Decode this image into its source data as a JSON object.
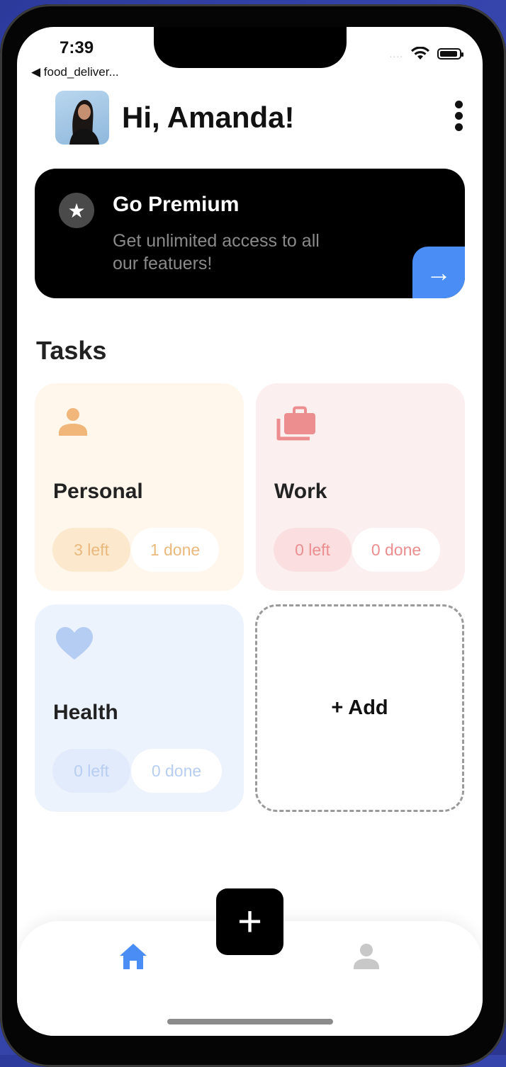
{
  "status_bar": {
    "time": "7:39",
    "back_app": "◀ food_deliver...",
    "signal": "....",
    "wifi_icon": "wifi-icon",
    "battery_icon": "battery-icon"
  },
  "header": {
    "greeting": "Hi, Amanda!",
    "avatar_icon": "user-avatar",
    "menu_icon": "more-vertical-icon"
  },
  "premium": {
    "icon": "star-icon",
    "star_glyph": "★",
    "title": "Go Premium",
    "subtitle": "Get unlimited access to all our featuers!",
    "arrow_glyph": "→",
    "arrow_icon": "arrow-right-icon",
    "accent_color": "#4a8ef5"
  },
  "tasks": {
    "title": "Tasks",
    "cards": [
      {
        "title": "Personal",
        "icon": "person-icon",
        "left": "3 left",
        "done": "1 done",
        "color": "#ebb87d",
        "bg": "#fff6ec"
      },
      {
        "title": "Work",
        "icon": "briefcase-icon",
        "left": "0 left",
        "done": "0 done",
        "color": "#ec8d8f",
        "bg": "#fcefef"
      },
      {
        "title": "Health",
        "icon": "heart-icon",
        "left": "0 left",
        "done": "0 done",
        "color": "#b8cdf2",
        "bg": "#edf3fd"
      }
    ],
    "add_label": "+ Add"
  },
  "bottom_nav": {
    "fab_glyph": "+",
    "fab_icon": "plus-icon",
    "home_icon": "home-icon",
    "home_color": "#4a8ef5",
    "profile_icon": "profile-icon",
    "profile_color": "#c8c8c8"
  }
}
